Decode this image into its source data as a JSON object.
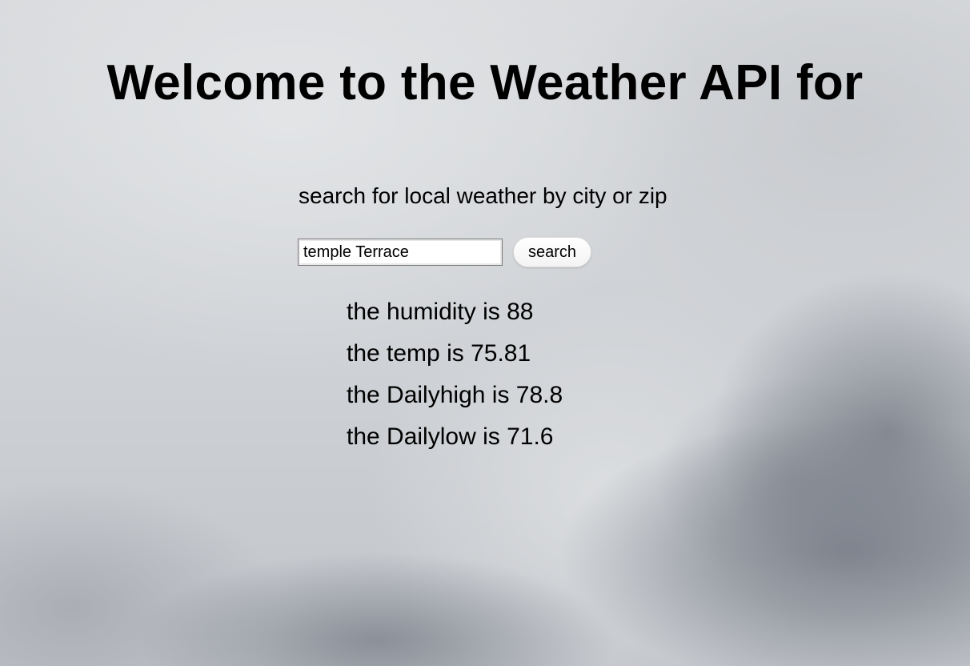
{
  "header": {
    "title": "Welcome to the Weather API for"
  },
  "search": {
    "prompt": "search for local weather by city or zip",
    "input_value": "temple Terrace",
    "button_label": "search"
  },
  "results": [
    "the humidity is 88",
    "the temp is 75.81",
    "the Dailyhigh is 78.8",
    "the Dailylow is 71.6"
  ],
  "theme": {
    "background": "#cfd2d6",
    "text": "#000000"
  }
}
